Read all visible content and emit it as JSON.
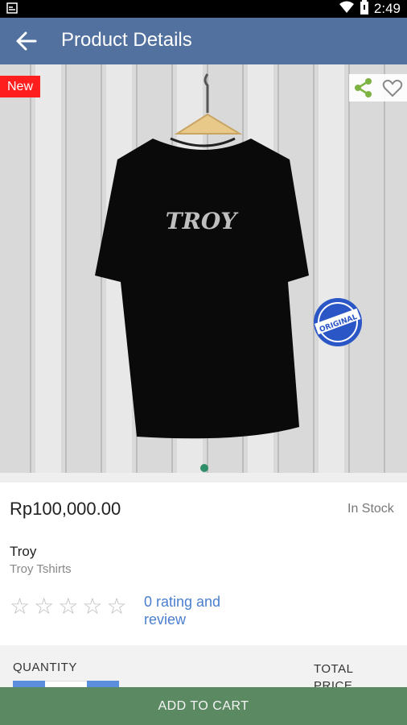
{
  "status_bar": {
    "time": "2:49",
    "icons": [
      "notification-icon",
      "wifi-icon",
      "battery-icon"
    ]
  },
  "app_bar": {
    "title": "Product Details",
    "back_icon": "arrow-back-icon"
  },
  "product": {
    "badge": "New",
    "image_alt": "Black Troy T-shirt on hanger",
    "price": "Rp100,000.00",
    "stock_status": "In Stock",
    "brand": "Troy",
    "category": "Troy Tshirts",
    "rating_value": 0,
    "rating_max": 5,
    "rating_link": "0 rating and review",
    "shirt_print": "TROY",
    "seal_text": "ORIGINAL"
  },
  "quantity": {
    "label": "QUANTITY",
    "total_label": "TOTAL PRICE"
  },
  "cart": {
    "button_label": "ADD TO CART"
  },
  "colors": {
    "app_bar": "#52719f",
    "badge": "#ff1e1e",
    "share": "#7cb342",
    "link": "#4a7fd0",
    "cart": "#5b8a62"
  }
}
